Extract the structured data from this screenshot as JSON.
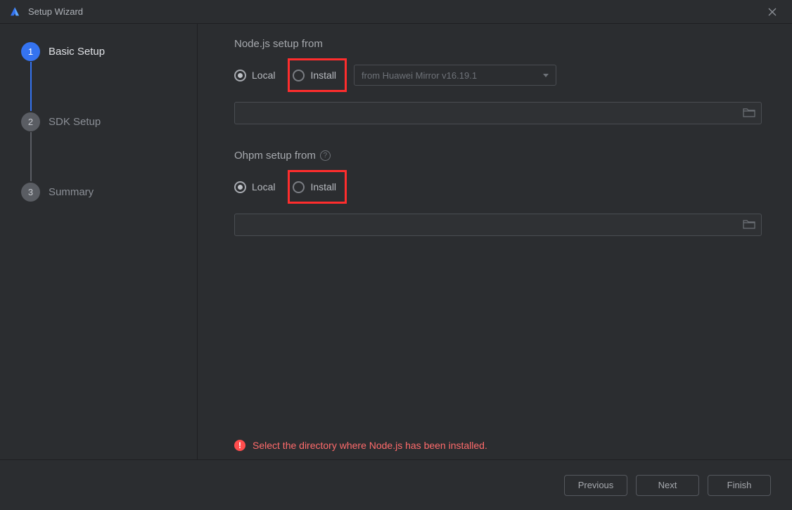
{
  "window": {
    "title": "Setup Wizard"
  },
  "sidebar": {
    "steps": [
      {
        "num": "1",
        "label": "Basic Setup"
      },
      {
        "num": "2",
        "label": "SDK Setup"
      },
      {
        "num": "3",
        "label": "Summary"
      }
    ]
  },
  "main": {
    "node": {
      "heading": "Node.js setup from",
      "local": "Local",
      "install": "Install",
      "dropdown": "from Huawei Mirror v16.19.1"
    },
    "ohpm": {
      "heading": "Ohpm setup from",
      "local": "Local",
      "install": "Install"
    },
    "error": "Select the directory where Node.js has been installed."
  },
  "footer": {
    "previous": "Previous",
    "next": "Next",
    "finish": "Finish"
  }
}
